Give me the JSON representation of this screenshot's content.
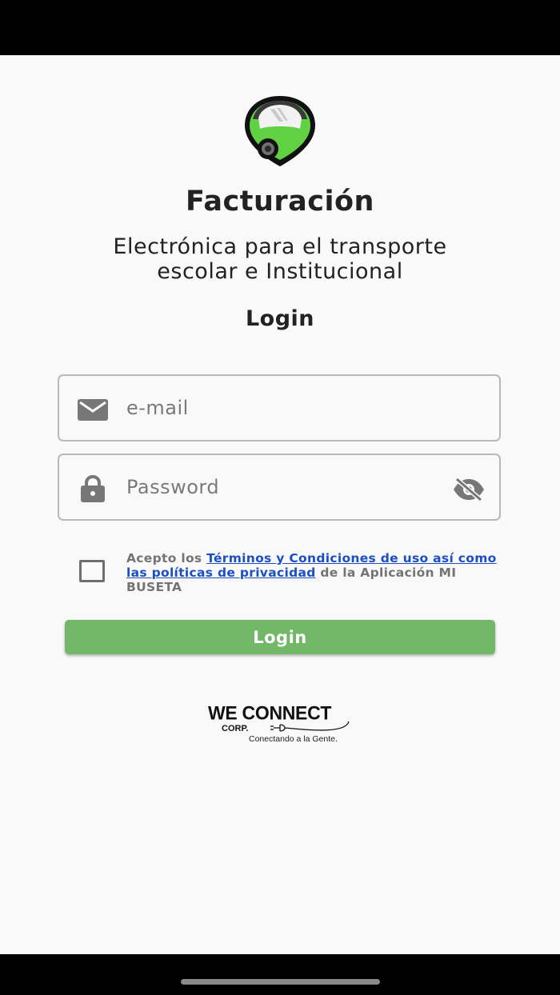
{
  "app": {
    "title": "Facturación",
    "subtitle_line1": "Electrónica para el transporte",
    "subtitle_line2": "escolar e Institucional",
    "login_heading": "Login"
  },
  "form": {
    "email": {
      "placeholder": "e-mail",
      "value": "",
      "icon": "mail-icon"
    },
    "password": {
      "placeholder": "Password",
      "value": "",
      "icon": "lock-icon",
      "toggle_icon": "eye-off-icon"
    },
    "terms": {
      "prefix": "Acepto los ",
      "link_text": "Términos y Condiciones de uso así como las políticas de privacidad",
      "suffix": " de la Aplicación MI BUSETA",
      "checked": false
    },
    "login_button_label": "Login"
  },
  "footer": {
    "brand_name": "WE CONNECT",
    "brand_corp": "CORP.",
    "brand_tagline": "Conectando a la Gente."
  },
  "colors": {
    "accent": "#72b868",
    "link": "#1c4fc2",
    "logo_green": "#5fd143",
    "background": "#f9f9f9"
  }
}
